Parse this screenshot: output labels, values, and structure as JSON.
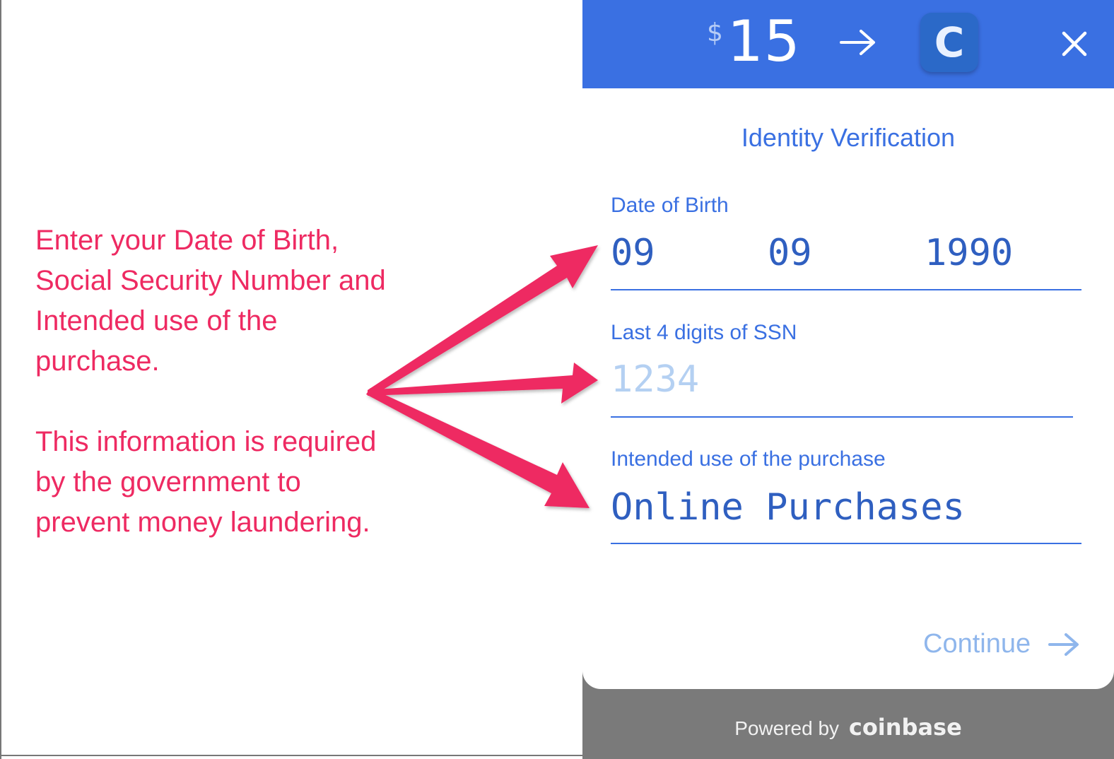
{
  "annotation": {
    "paragraph1": "Enter your Date of Birth, Social Security Number and Intended use of the purchase.",
    "paragraph2": "This information is required by the government to prevent money laundering."
  },
  "header": {
    "currency": "$",
    "amount": "15",
    "coin_letter": "C",
    "arrow_icon": "arrow-right-icon",
    "close_icon": "close-icon"
  },
  "form": {
    "title": "Identity Verification",
    "dob": {
      "label": "Date of Birth",
      "month": "09",
      "day": "09",
      "year": "1990"
    },
    "ssn": {
      "label": "Last 4 digits of SSN",
      "placeholder": "1234"
    },
    "use": {
      "label": "Intended use of the purchase",
      "value": "Online Purchases"
    },
    "continue_label": "Continue"
  },
  "footer": {
    "powered_label": "Powered by",
    "brand": "coinbase"
  },
  "colors": {
    "annotation": "#ee2a62",
    "header_bg": "#3a70e2",
    "footer_bg": "#7a7a7a"
  }
}
